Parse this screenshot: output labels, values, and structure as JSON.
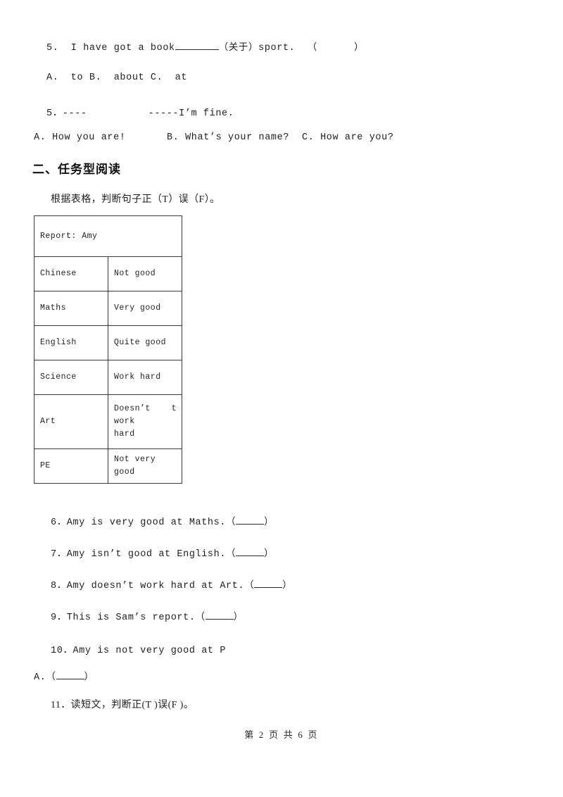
{
  "document": {
    "type": "exam-worksheet",
    "language": "zh-CN/en",
    "page_background": "#ffffff",
    "text_color": "#1e1e1e"
  },
  "questions_top": {
    "q5_stem_pre": "5.  I have got a book",
    "q5_stem_post": "（关于）sport.  （      ）",
    "q5_options": "A.  to B.  about C.  at",
    "q5b_stem": "5．----          -----I’m fine.",
    "q5b_option_a": "A. How you are!",
    "q5b_option_b": "B. What’s your name?",
    "q5b_option_c": "C. How are you?"
  },
  "section_two": {
    "heading": "二、任务型阅读",
    "instruction": "根据表格，判断句子正（T）误（F）。"
  },
  "report_table": {
    "title": "Report: Amy",
    "rows": [
      {
        "subject": "Chinese",
        "comment": "Not good"
      },
      {
        "subject": "Maths",
        "comment": "Very good"
      },
      {
        "subject": "English",
        "comment": "Quite good"
      },
      {
        "subject": "Science",
        "comment": "Work hard"
      },
      {
        "subject": "Art",
        "comment_line1": "Doesn’t",
        "comment_line1b": "t",
        "comment_line2": "work",
        "comment_line3": "hard"
      },
      {
        "subject": "PE",
        "comment": "Not very good"
      }
    ]
  },
  "tf_questions": {
    "q6": "6．Amy is very good at Maths.（",
    "q6_tail": "）",
    "q7": "7．Amy isn’t good at English.（",
    "q7_tail": "）",
    "q8": "8．Amy doesn’t work hard at Art.（",
    "q8_tail": "）",
    "q9": "9．This is Sam’s report.（",
    "q9_tail": "）",
    "q10": "10．Amy is not very good at P",
    "q10_answer_label": "A.（",
    "q10_answer_tail": "）",
    "q11": "11．读短文，判断正(T )误(F )。"
  },
  "footer": {
    "text": "第 2 页 共 6 页"
  }
}
